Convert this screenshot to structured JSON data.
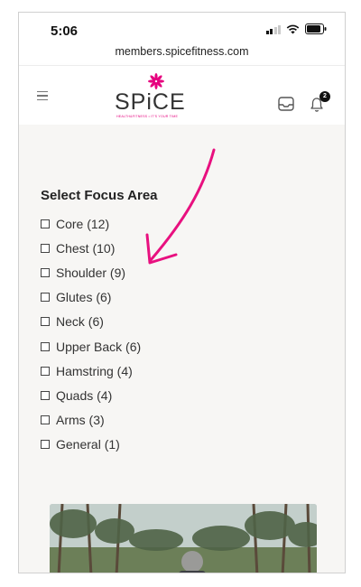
{
  "status_bar": {
    "time": "5:06"
  },
  "browser": {
    "url": "members.spicefitness.com"
  },
  "header": {
    "logo_text": "SPiCE",
    "logo_tagline": "HEALTH&FITNESS • IT'S YOUR TIME",
    "notification_count": "2"
  },
  "focus_area": {
    "title": "Select Focus Area",
    "options": [
      {
        "label": "Core (12)",
        "checked": false
      },
      {
        "label": "Chest (10)",
        "checked": false
      },
      {
        "label": "Shoulder (9)",
        "checked": false
      },
      {
        "label": "Glutes (6)",
        "checked": false
      },
      {
        "label": "Neck (6)",
        "checked": false
      },
      {
        "label": "Upper Back (6)",
        "checked": false
      },
      {
        "label": "Hamstring (4)",
        "checked": false
      },
      {
        "label": "Quads (4)",
        "checked": false
      },
      {
        "label": "Arms (3)",
        "checked": false
      },
      {
        "label": "General (1)",
        "checked": false
      }
    ]
  },
  "colors": {
    "accent": "#e6007e",
    "annotation_arrow": "#e8107f",
    "page_bg": "#f7f6f4"
  },
  "icons": {
    "menu": "hamburger-icon",
    "inbox": "inbox-icon",
    "notifications": "bell-icon"
  }
}
